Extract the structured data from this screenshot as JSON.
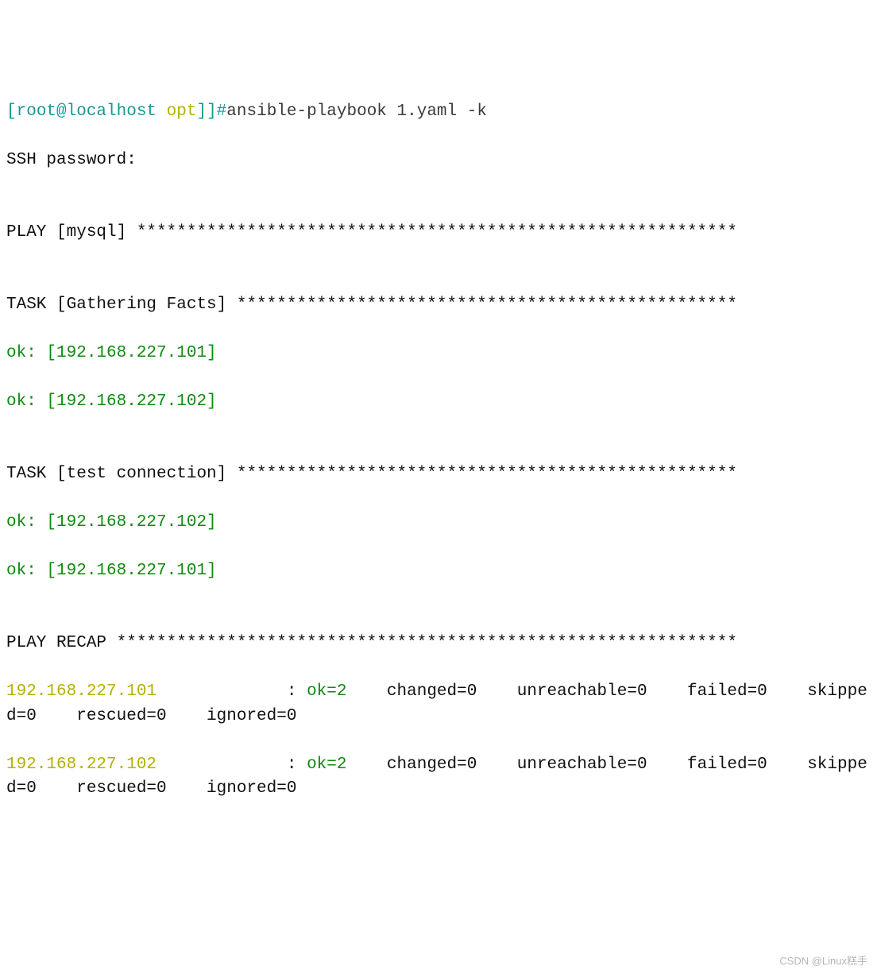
{
  "prompt": {
    "bracket_open": "[",
    "user_host": "root@localhost",
    "cwd": " opt",
    "bracket_close": "]]#",
    "command": "ansible-playbook 1.yaml -k"
  },
  "ssh_line": "SSH password:",
  "blank": "",
  "play_header_1": "PLAY [mysql] ************************************************************",
  "gathering_header_1": "TASK [Gathering Facts] **************************************************",
  "ok1": "ok: [192.168.227.101]",
  "ok2": "ok: [192.168.227.102]",
  "test_header_1": "TASK [test connection] **************************************************",
  "ok3": "ok: [192.168.227.102]",
  "ok4": "ok: [192.168.227.101]",
  "recap_header_1": "PLAY RECAP **************************************************************",
  "recap1": {
    "host": "192.168.227.101",
    "pad": "            ",
    "colon": " : ",
    "ok": "ok=2",
    "rest": "    changed=0    unreachable=0    failed=0    skipped=0    rescued=0    ignored=0"
  },
  "recap2": {
    "host": "192.168.227.102",
    "pad": "            ",
    "colon": " : ",
    "ok": "ok=2",
    "rest": "    changed=0    unreachable=0    failed=0    skipped=0    rescued=0    ignored=0"
  },
  "watermark": "CSDN @Linux糕手"
}
